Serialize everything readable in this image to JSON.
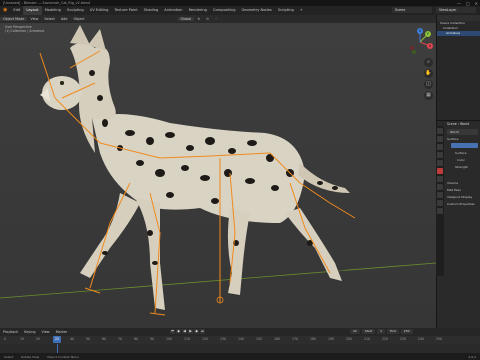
{
  "window": {
    "title": "[Unsaved] - Blender — Savannah_Cat_Rig_v2.blend",
    "buttons": [
      "—",
      "□",
      "✕"
    ]
  },
  "menubar": {
    "items": [
      "Edit",
      "Layout",
      "Modeling",
      "Sculpting",
      "UV Editing",
      "Texture Paint",
      "Shading",
      "Animation",
      "Rendering",
      "Compositing",
      "Geometry Nodes",
      "Scripting",
      "+"
    ],
    "active_index": 1,
    "scene": "Scene",
    "view_layer": "ViewLayer"
  },
  "viewport_header": {
    "left_items": [
      "Object Mode",
      "View",
      "Select",
      "Add",
      "Object"
    ],
    "center_items": [
      "Global",
      "↻",
      "⊙",
      "⁘"
    ]
  },
  "viewport": {
    "stats_line1": "User Perspective",
    "stats_line2": "(1) Collection | Armature",
    "gizmo": {
      "x": "X",
      "y": "Y",
      "z": "Z"
    }
  },
  "outliner": {
    "rows": [
      {
        "label": "Scene Collection",
        "selected": false
      },
      {
        "label": "Collection",
        "selected": false
      },
      {
        "label": "Armature",
        "selected": true
      }
    ]
  },
  "properties": {
    "header": "Scene  ›  World",
    "world_name": "World",
    "panel": "Surface",
    "fields": [
      "Surface",
      "Color",
      "Strength"
    ],
    "sections": [
      "Volume",
      "Mist Pass",
      "Viewport Display",
      "Custom Properties"
    ]
  },
  "timeline": {
    "menu": [
      "Playback",
      "Keying",
      "View",
      "Marker"
    ],
    "current_frame": "22",
    "start_label": "Start",
    "start": "1",
    "end_label": "End",
    "end": "250",
    "ticks": [
      "0",
      "10",
      "20",
      "30",
      "40",
      "50",
      "60",
      "70",
      "80",
      "90",
      "100",
      "110",
      "120",
      "130",
      "140",
      "150",
      "160",
      "170",
      "180",
      "190",
      "200",
      "210",
      "220",
      "230",
      "240",
      "250"
    ]
  },
  "statusbar": {
    "items": [
      "Select",
      "Rotate View",
      "Object Context Menu",
      "4.0.2"
    ]
  }
}
